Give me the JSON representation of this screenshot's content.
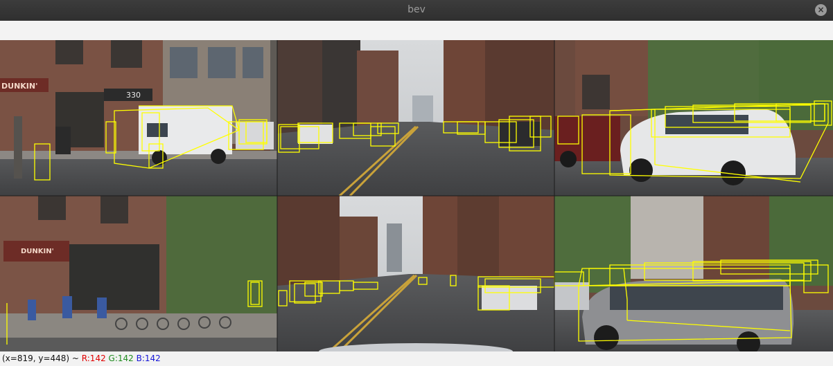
{
  "window": {
    "title": "bev"
  },
  "status": {
    "coord_text": "(x=819, y=448) ~ ",
    "r_text": "R:142 ",
    "g_text": "G:142 ",
    "b_text": "B:142"
  },
  "colors": {
    "box": "#ffff00",
    "titlebar": "#333333"
  }
}
